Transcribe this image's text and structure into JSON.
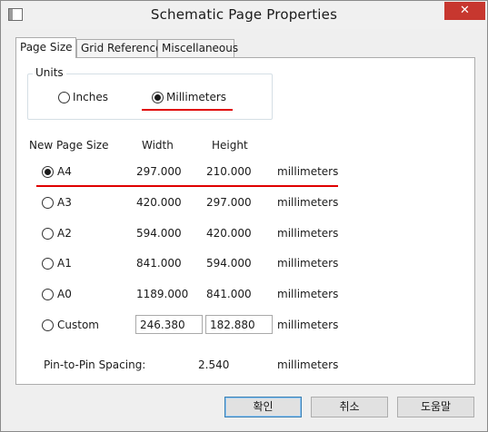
{
  "window": {
    "title": "Schematic Page Properties",
    "close_glyph": "✕"
  },
  "tabs": [
    {
      "label": "Page Size",
      "active": true
    },
    {
      "label": "Grid Reference",
      "active": false
    },
    {
      "label": "Miscellaneous",
      "active": false
    }
  ],
  "units": {
    "legend": "Units",
    "options": [
      {
        "label": "Inches",
        "selected": false
      },
      {
        "label": "Millimeters",
        "selected": true
      }
    ]
  },
  "sizes": {
    "headers": {
      "name": "New Page Size",
      "width": "Width",
      "height": "Height"
    },
    "rows": [
      {
        "name": "A4",
        "width": "297.000",
        "height": "210.000",
        "unit": "millimeters",
        "selected": true
      },
      {
        "name": "A3",
        "width": "420.000",
        "height": "297.000",
        "unit": "millimeters",
        "selected": false
      },
      {
        "name": "A2",
        "width": "594.000",
        "height": "420.000",
        "unit": "millimeters",
        "selected": false
      },
      {
        "name": "A1",
        "width": "841.000",
        "height": "594.000",
        "unit": "millimeters",
        "selected": false
      },
      {
        "name": "A0",
        "width": "1189.000",
        "height": "841.000",
        "unit": "millimeters",
        "selected": false
      }
    ],
    "custom": {
      "name": "Custom",
      "width": "246.380",
      "height": "182.880",
      "unit": "millimeters",
      "selected": false
    }
  },
  "spacing": {
    "label": "Pin-to-Pin Spacing:",
    "value": "2.540",
    "unit": "millimeters"
  },
  "buttons": {
    "ok": "확인",
    "cancel": "취소",
    "help": "도움말"
  },
  "accent_colors": {
    "annotation_red": "#e00000",
    "close_button": "#c7372f"
  }
}
